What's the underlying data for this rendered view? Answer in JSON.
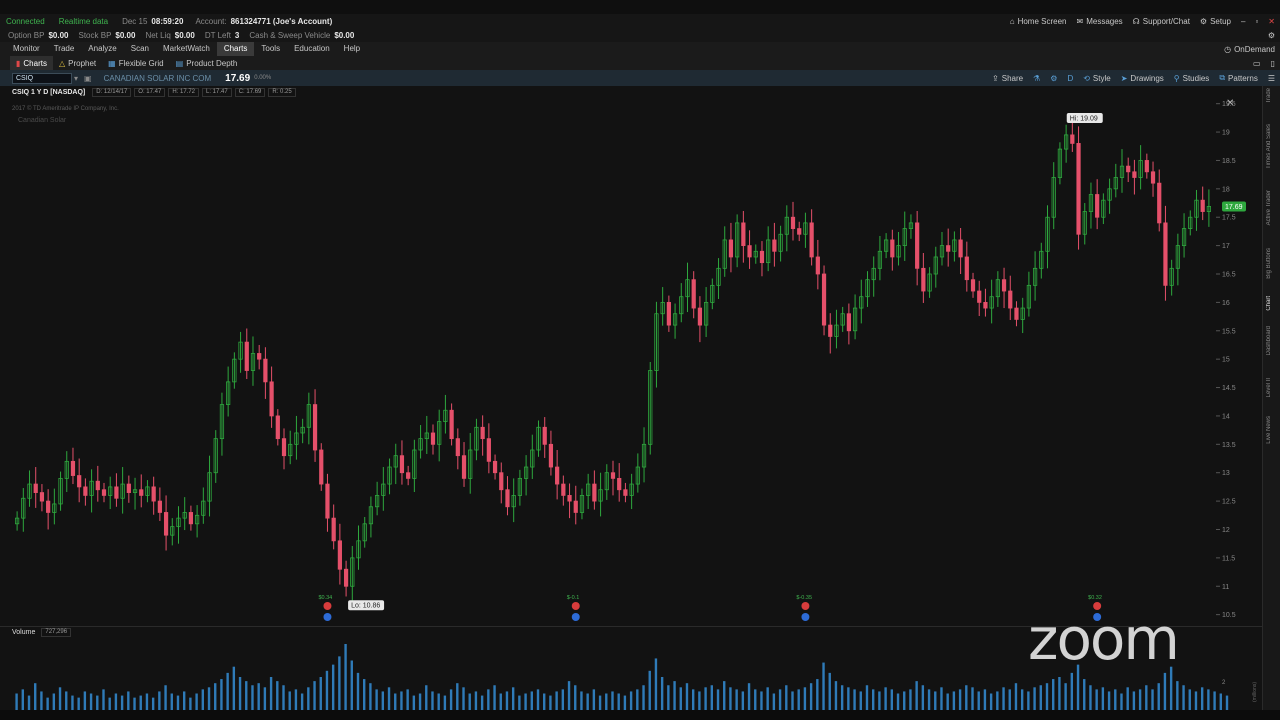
{
  "status": {
    "connected": "Connected",
    "realtime": "Realtime data",
    "date": "Dec 15",
    "time": "08:59:20",
    "account_label": "Account:",
    "account_value": "861324771 (Joe's Account)"
  },
  "right_top": {
    "home": "Home Screen",
    "messages": "Messages",
    "support": "Support/Chat",
    "setup": "Setup"
  },
  "balances": [
    {
      "label": "Option BP",
      "value": "$0.00"
    },
    {
      "label": "Stock BP",
      "value": "$0.00"
    },
    {
      "label": "Net Liq",
      "value": "$0.00"
    },
    {
      "label": "DT Left",
      "value": "3"
    },
    {
      "label": "Cash & Sweep Vehicle",
      "value": "$0.00"
    }
  ],
  "menu": [
    "Monitor",
    "Trade",
    "Analyze",
    "Scan",
    "MarketWatch",
    "Charts",
    "Tools",
    "Education",
    "Help"
  ],
  "menu_active": "Charts",
  "ondemand": "OnDemand",
  "subtabs": [
    "Charts",
    "Prophet",
    "Flexible Grid",
    "Product Depth"
  ],
  "symbol": {
    "ticker": "CSIQ",
    "company": "CANADIAN SOLAR INC COM",
    "price": "17.69",
    "change": "0.00%"
  },
  "toolbar": {
    "share": "Share",
    "period": "D",
    "style": "Style",
    "drawings": "Drawings",
    "studies": "Studies",
    "patterns": "Patterns"
  },
  "info": {
    "title": "CSIQ 1 Y D [NASDAQ]",
    "boxes": [
      "D: 12/14/17",
      "O: 17.47",
      "H: 17.72",
      "L: 17.47",
      "C: 17.69",
      "R: 0.25"
    ],
    "copyright": "2017 © TD Ameritrade IP Company, Inc.",
    "watermark": "Canadian Solar"
  },
  "volume": {
    "label": "Volume",
    "value": "727,296",
    "scale_label": "(millions)",
    "ticks": [
      "2"
    ]
  },
  "side_tabs": [
    "Trade",
    "Times And Sales",
    "Active Trader",
    "Big Buttons",
    "Chart",
    "Dashboard",
    "Level II",
    "Live News"
  ],
  "side_active": "Chart",
  "overlay": "zoom",
  "chart_data": {
    "type": "candlestick",
    "title": "CSIQ 1 Y D [NASDAQ]",
    "ylim": [
      10.3,
      19.6
    ],
    "y_ticks": [
      "10.5",
      "11",
      "11.5",
      "12",
      "12.5",
      "13",
      "13.5",
      "14",
      "14.5",
      "15",
      "15.5",
      "16",
      "16.5",
      "17",
      "17.5",
      "18",
      "18.5",
      "19",
      "19.5"
    ],
    "hi_label": "Hi: 19.09",
    "lo_label": "Lo: 10.86",
    "last_label": "17.69",
    "hi_index": 172,
    "lo_index": 53,
    "events": [
      {
        "index": 50,
        "label": "$0.34"
      },
      {
        "index": 90,
        "label": "$-0.1"
      },
      {
        "index": 127,
        "label": "$-0.35"
      },
      {
        "index": 174,
        "label": "$0.32"
      }
    ],
    "closes": [
      12.2,
      12.55,
      12.8,
      12.65,
      12.5,
      12.3,
      12.45,
      12.9,
      13.2,
      12.95,
      12.75,
      12.6,
      12.85,
      12.7,
      12.6,
      12.75,
      12.55,
      12.8,
      12.65,
      12.7,
      12.6,
      12.75,
      12.5,
      12.3,
      11.9,
      12.05,
      12.2,
      12.3,
      12.1,
      12.25,
      12.5,
      13.0,
      13.6,
      14.2,
      14.6,
      15.0,
      15.3,
      14.8,
      15.1,
      15.0,
      14.6,
      14.0,
      13.6,
      13.3,
      13.5,
      13.7,
      13.8,
      14.2,
      13.4,
      12.8,
      12.2,
      11.8,
      11.3,
      11.0,
      11.5,
      11.8,
      12.1,
      12.4,
      12.6,
      12.8,
      13.1,
      13.3,
      13.0,
      12.9,
      13.4,
      13.6,
      13.7,
      13.5,
      13.9,
      14.1,
      13.6,
      13.3,
      12.9,
      13.4,
      13.8,
      13.6,
      13.2,
      13.0,
      12.7,
      12.4,
      12.6,
      12.9,
      13.1,
      13.4,
      13.8,
      13.5,
      13.1,
      12.8,
      12.6,
      12.5,
      12.3,
      12.6,
      12.8,
      12.5,
      12.7,
      13.0,
      12.9,
      12.7,
      12.6,
      12.8,
      13.1,
      13.5,
      14.8,
      15.8,
      16.0,
      15.6,
      15.8,
      16.1,
      16.4,
      15.9,
      15.6,
      16.0,
      16.3,
      16.6,
      17.1,
      16.8,
      17.4,
      17.0,
      16.8,
      16.9,
      16.7,
      17.1,
      16.9,
      17.2,
      17.5,
      17.3,
      17.2,
      17.4,
      16.8,
      16.5,
      15.6,
      15.4,
      15.6,
      15.8,
      15.5,
      15.9,
      16.1,
      16.4,
      16.6,
      16.9,
      17.1,
      16.8,
      17.0,
      17.3,
      17.4,
      16.6,
      16.2,
      16.5,
      16.8,
      17.0,
      16.9,
      17.1,
      16.8,
      16.4,
      16.2,
      16.0,
      15.9,
      16.1,
      16.4,
      16.2,
      15.9,
      15.7,
      15.9,
      16.3,
      16.6,
      16.9,
      17.5,
      18.2,
      18.7,
      18.95,
      18.8,
      17.2,
      17.6,
      17.9,
      17.5,
      17.8,
      18.0,
      18.2,
      18.4,
      18.3,
      18.2,
      18.5,
      18.3,
      18.1,
      17.4,
      16.3,
      16.6,
      17.0,
      17.3,
      17.5,
      17.8,
      17.6,
      17.69
    ],
    "volumes": [
      0.8,
      1.0,
      0.7,
      1.3,
      0.9,
      0.6,
      0.8,
      1.1,
      0.9,
      0.7,
      0.6,
      0.9,
      0.8,
      0.7,
      1.0,
      0.6,
      0.8,
      0.7,
      0.9,
      0.6,
      0.7,
      0.8,
      0.6,
      0.9,
      1.2,
      0.8,
      0.7,
      0.9,
      0.6,
      0.8,
      1.0,
      1.1,
      1.3,
      1.5,
      1.8,
      2.1,
      1.6,
      1.4,
      1.2,
      1.3,
      1.1,
      1.6,
      1.4,
      1.2,
      0.9,
      1.0,
      0.8,
      1.1,
      1.4,
      1.6,
      1.9,
      2.2,
      2.6,
      3.2,
      2.4,
      1.8,
      1.5,
      1.3,
      1.0,
      0.9,
      1.1,
      0.8,
      0.9,
      1.0,
      0.7,
      0.8,
      1.2,
      0.9,
      0.8,
      0.7,
      1.0,
      1.3,
      1.1,
      0.8,
      0.9,
      0.7,
      1.0,
      1.2,
      0.8,
      0.9,
      1.1,
      0.7,
      0.8,
      0.9,
      1.0,
      0.8,
      0.7,
      0.9,
      1.0,
      1.4,
      1.2,
      0.9,
      0.8,
      1.0,
      0.7,
      0.8,
      0.9,
      0.8,
      0.7,
      0.9,
      1.0,
      1.2,
      1.9,
      2.5,
      1.6,
      1.2,
      1.4,
      1.1,
      1.3,
      1.0,
      0.9,
      1.1,
      1.2,
      1.0,
      1.4,
      1.1,
      1.0,
      0.9,
      1.3,
      1.0,
      0.9,
      1.1,
      0.8,
      1.0,
      1.2,
      0.9,
      1.0,
      1.1,
      1.3,
      1.5,
      2.3,
      1.8,
      1.4,
      1.2,
      1.1,
      1.0,
      0.9,
      1.2,
      1.0,
      0.9,
      1.1,
      1.0,
      0.8,
      0.9,
      1.0,
      1.4,
      1.2,
      1.0,
      0.9,
      1.1,
      0.8,
      0.9,
      1.0,
      1.2,
      1.1,
      0.9,
      1.0,
      0.8,
      0.9,
      1.1,
      1.0,
      1.3,
      1.0,
      0.9,
      1.1,
      1.2,
      1.3,
      1.5,
      1.6,
      1.3,
      1.8,
      2.2,
      1.5,
      1.2,
      1.0,
      1.1,
      0.9,
      1.0,
      0.8,
      1.1,
      0.9,
      1.0,
      1.2,
      1.0,
      1.3,
      1.8,
      2.1,
      1.4,
      1.2,
      1.0,
      0.9,
      1.1,
      1.0,
      0.9,
      0.8,
      0.7
    ]
  }
}
